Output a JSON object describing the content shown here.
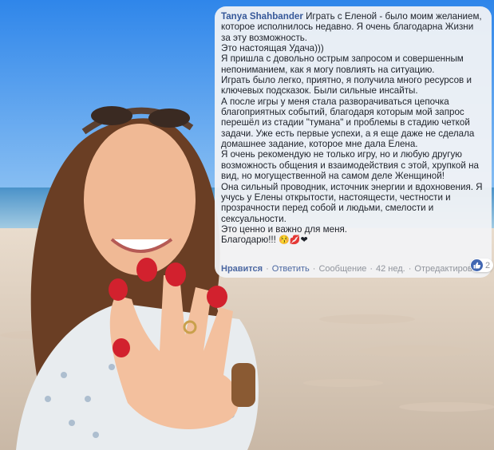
{
  "comment": {
    "author": "Tanya Shahbander",
    "text": " Играть с Еленой - было моим желанием, которое исполнилось недавно. Я очень благодарна Жизни за эту возможность.\nЭто настоящая Удача)))\nЯ пришла с довольно острым запросом и совершенным непониманием, как я могу повлиять на ситуацию.\nИграть было легко, приятно, я получила много ресурсов и ключевых подсказок. Были сильные инсайты.\nА после игры у меня стала разворачиваться цепочка благоприятных событий, благодаря которым мой запрос перешёл из стадии \"тумана\" и проблемы в стадию четкой задачи. Уже есть первые успехи, а я еще даже не сделала домашнее задание, которое мне дала Елена.\nЯ очень рекомендую не только игру, но и любую другую возможность общения и взаимодействия с этой, хрупкой на вид, но могущественной на самом деле Женщиной!\nОна сильный проводник, источник энергии и вдохновения. Я учусь у Елены открытости, настоящести, честности и прозрачности перед собой и людьми, смелости и сексуальности.\nЭто ценно и важно для меня.\nБлагодарю!!! ",
    "emojis": "😚💋❤"
  },
  "actions": {
    "like": "Нравится",
    "reply": "Ответить",
    "message": "Сообщение",
    "time": "42 нед.",
    "edited": "Отредактирован"
  },
  "reactions": {
    "icon": "thumbs-up-icon",
    "count": "2"
  },
  "colors": {
    "author_link": "#365899",
    "action_link": "#4b67a1",
    "meta_text": "#90949c",
    "like_badge": "#4267b2"
  }
}
